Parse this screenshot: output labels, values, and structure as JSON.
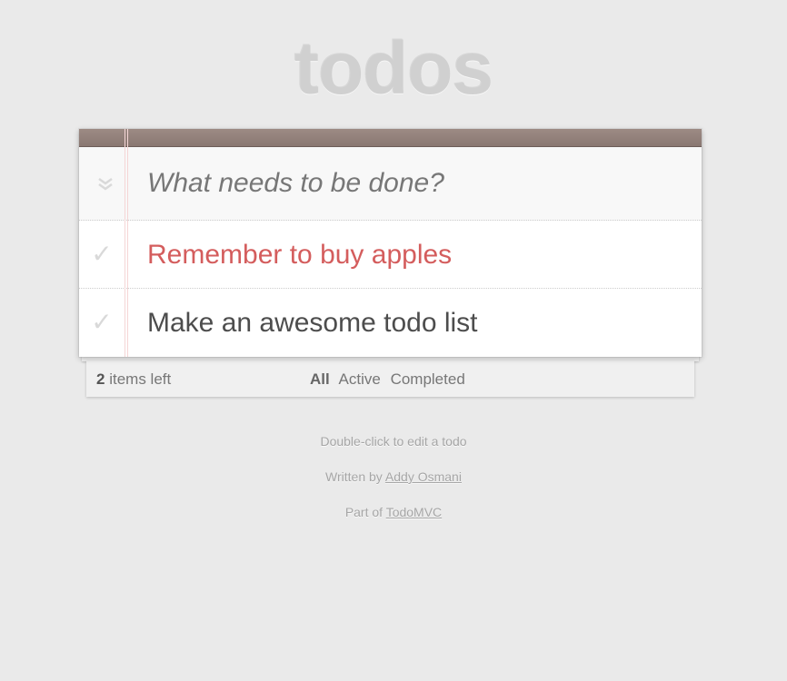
{
  "header": {
    "title": "todos"
  },
  "new_todo": {
    "placeholder": "What needs to be done?",
    "toggle_all_icon": "double-chevron-down-icon"
  },
  "todos": [
    {
      "label": "Remember to buy apples",
      "completed": false,
      "editing_color": "#d45d5d"
    },
    {
      "label": "Make an awesome todo list",
      "completed": false
    }
  ],
  "footer": {
    "count": "2",
    "count_suffix": "items left",
    "filters": [
      "All",
      "Active",
      "Completed"
    ],
    "selected_filter": "All"
  },
  "info": {
    "hint": "Double-click to edit a todo",
    "written_by_prefix": "Written by",
    "author": "Addy Osmani",
    "part_of_prefix": "Part of",
    "project": "TodoMVC"
  },
  "colors": {
    "background": "#eaeaea",
    "header_bar": "#8a7872",
    "title": "#d0d0d0"
  }
}
